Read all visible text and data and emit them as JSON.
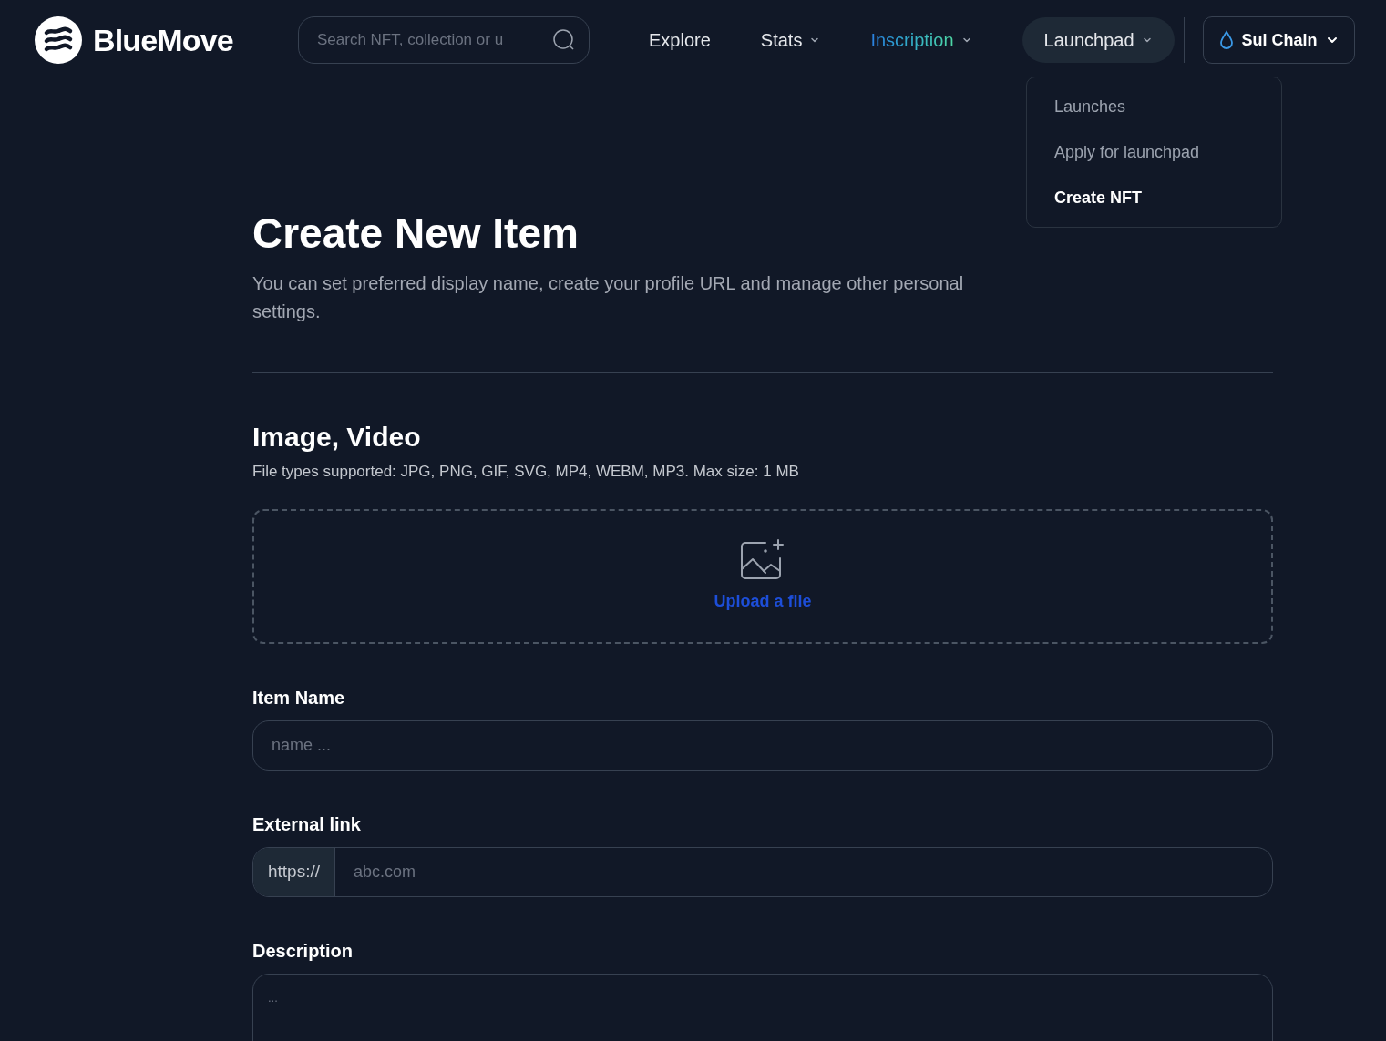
{
  "brand": {
    "name": "BlueMove"
  },
  "search": {
    "placeholder": "Search NFT, collection or u"
  },
  "nav": [
    {
      "label": "Explore",
      "has_menu": false,
      "open": false,
      "highlighted": false
    },
    {
      "label": "Stats",
      "has_menu": true,
      "open": false,
      "highlighted": false
    },
    {
      "label": "Inscription",
      "has_menu": true,
      "open": false,
      "highlighted": true
    },
    {
      "label": "Launchpad",
      "has_menu": true,
      "open": true,
      "highlighted": false
    }
  ],
  "chain_selector": {
    "label": "Sui Chain"
  },
  "launchpad_menu": [
    {
      "label": "Launches",
      "selected": false
    },
    {
      "label": "Apply for launchpad",
      "selected": false
    },
    {
      "label": "Create NFT",
      "selected": true
    }
  ],
  "page": {
    "title": "Create New Item",
    "subtitle": "You can set preferred display name, create your profile URL and manage other personal settings."
  },
  "media": {
    "heading": "Image, Video",
    "hint": "File types supported: JPG, PNG, GIF, SVG, MP4, WEBM, MP3. Max size: 1 MB",
    "upload_label": "Upload a file"
  },
  "item_name": {
    "label": "Item Name",
    "placeholder": "name ..."
  },
  "external_link": {
    "label": "External link",
    "prefix": "https://",
    "placeholder": "abc.com"
  },
  "description": {
    "label": "Description",
    "placeholder": "..."
  }
}
